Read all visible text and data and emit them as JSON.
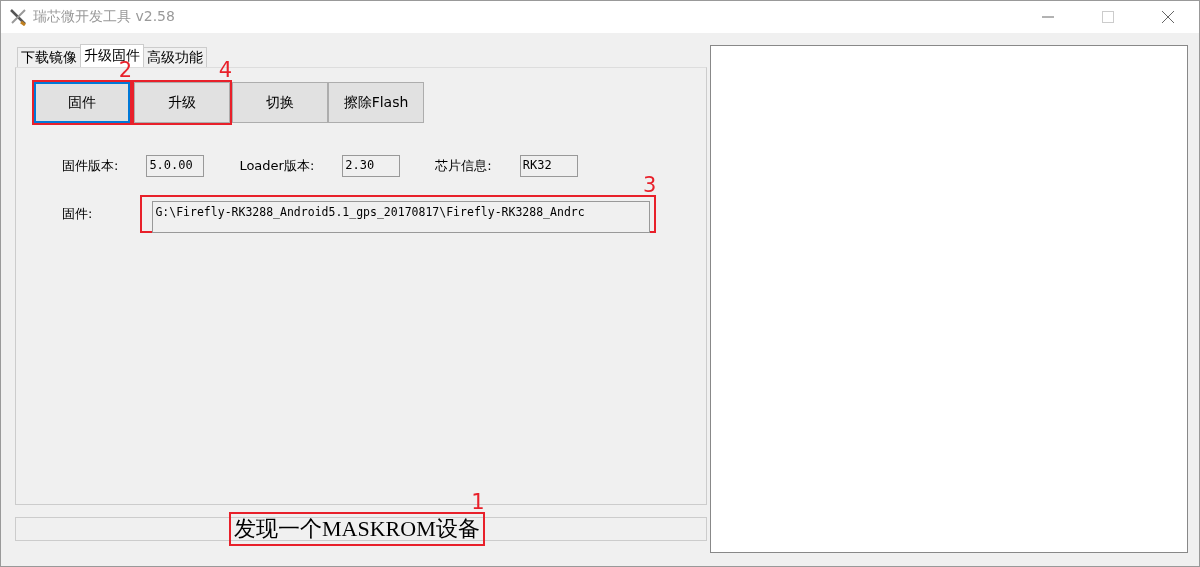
{
  "window": {
    "title": "瑞芯微开发工具 v2.58"
  },
  "tabs": [
    {
      "label": "下载镜像",
      "selected": false
    },
    {
      "label": "升级固件",
      "selected": true
    },
    {
      "label": "高级功能",
      "selected": false
    }
  ],
  "buttons": [
    {
      "label": "固件",
      "focused": true,
      "annotation": "2"
    },
    {
      "label": "升级",
      "focused": false,
      "annotation": "4"
    },
    {
      "label": "切换",
      "focused": false
    },
    {
      "label": "擦除Flash",
      "focused": false
    }
  ],
  "info": [
    {
      "label": "固件版本:",
      "value": "5.0.00"
    },
    {
      "label": "Loader版本:",
      "value": "2.30"
    },
    {
      "label": "芯片信息:",
      "value": "RK32"
    }
  ],
  "firmware": {
    "label": "固件:",
    "value": "G:\\Firefly-RK3288_Android5.1_gps_20170817\\Firefly-RK3288_Andrc",
    "annotation": "3"
  },
  "status": {
    "text": "发现一个MASKROM设备",
    "annotation": "1"
  }
}
